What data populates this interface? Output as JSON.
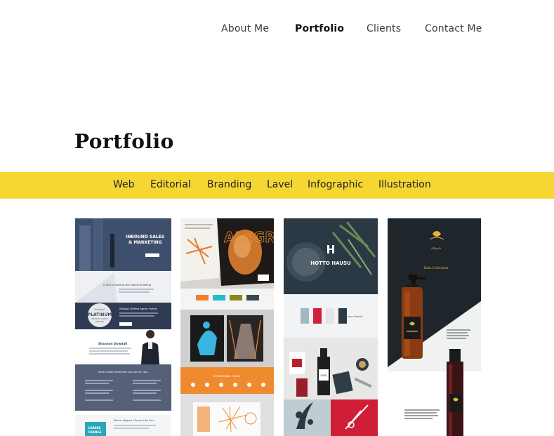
{
  "nav": {
    "items": [
      {
        "label": "About Me",
        "active": false
      },
      {
        "label": "Portfolio",
        "active": true
      },
      {
        "label": "Clients",
        "active": false
      },
      {
        "label": "Contact Me",
        "active": false
      }
    ]
  },
  "page": {
    "title": "Portfolio"
  },
  "filters": [
    "Web",
    "Editorial",
    "Branding",
    "Lavel",
    "Infographic",
    "Illustration"
  ],
  "tiles": [
    {
      "id": "web",
      "texts": {
        "hero_line1": "INBOUND SALES",
        "hero_line2": "& MARKETING",
        "guide_title": "A CEO's Guide to the Future of Selling",
        "badge_top": "HubSpot",
        "badge_main": "PLATINUM",
        "badge_sub1": "CERTIFIED AGENCY",
        "badge_sub2": "PARTNER",
        "badge_side": "HubSpot Certified Agency Partner",
        "person_name": "Shannon Dowdall",
        "services_title": "Here's what SalesHub can do for you:",
        "clients_title": "We've Helped Clients Like You",
        "book_text1": "CAREER",
        "book_text2": "CHANGE"
      }
    },
    {
      "id": "editorial",
      "texts": {
        "cover_word": "ALEGRE",
        "section_label": "OPERATIONAL TOOLS"
      },
      "swatches": [
        "#f07f2a",
        "#23bcd0",
        "#8a8a1a",
        "#3a4a45"
      ]
    },
    {
      "id": "branding",
      "texts": {
        "logo_text": "HOTTO HAUSU",
        "palette_label": "Colour Palette",
        "bottle_label": "SAKE"
      },
      "swatches": [
        "#9fb8c2",
        "#d0203a",
        "#e4e4e4",
        "#2c3a44"
      ]
    },
    {
      "id": "label",
      "texts": {
        "brand": "Alfiyah",
        "line": "Bath Collection"
      }
    }
  ]
}
